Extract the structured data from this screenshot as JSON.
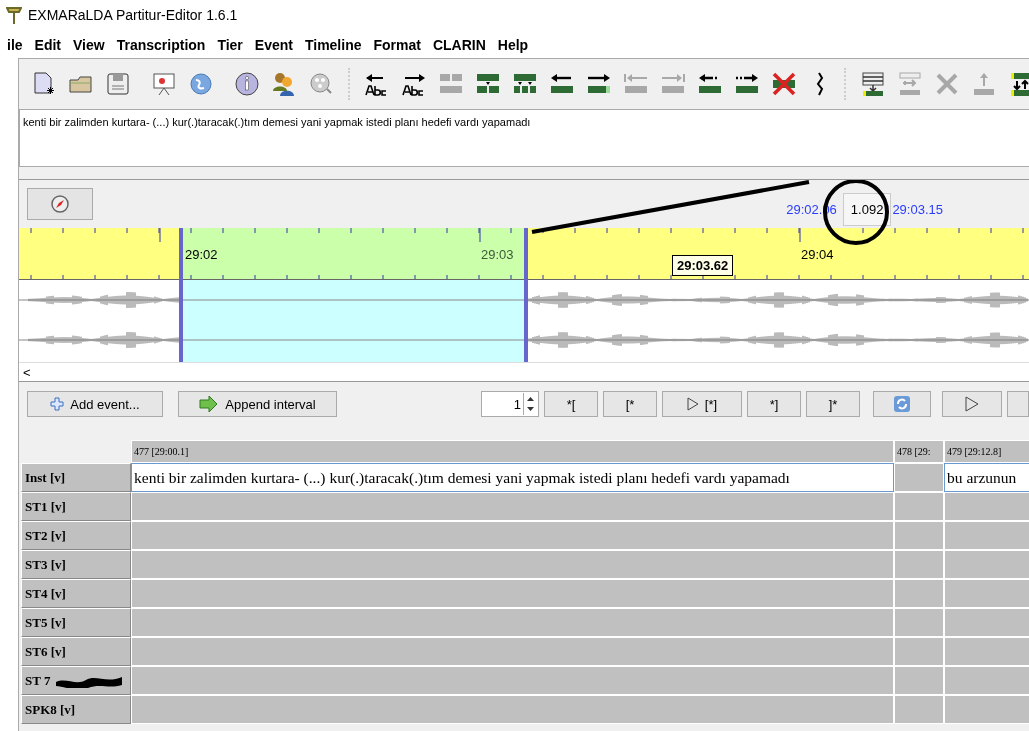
{
  "window": {
    "title": "EXMARaLDA Partitur-Editor 1.6.1"
  },
  "menu": [
    {
      "label": "ile"
    },
    {
      "label": "Edit"
    },
    {
      "label": "View"
    },
    {
      "label": "Transcription"
    },
    {
      "label": "Tier"
    },
    {
      "label": "Event"
    },
    {
      "label": "Timeline"
    },
    {
      "label": "Format"
    },
    {
      "label": "CLARIN"
    },
    {
      "label": "Help"
    }
  ],
  "transcript_text": "kenti bir zalimden kurtara- (...) kur(.)taracak(.)tım demesi yani yapmak istedi planı hedefi vardı yapamadı",
  "timeline": {
    "start_time": "29:02.06",
    "duration": "1.092",
    "end_time": "29:03.15",
    "ruler_labels": [
      "29:02",
      "29:03",
      "29:04"
    ],
    "cursor_time": "29:03.62",
    "scroll_left": "<"
  },
  "controls": {
    "add_event": "Add event...",
    "append_interval": "Append interval",
    "spinner_value": "1",
    "mark_buttons": [
      "*[",
      "[*",
      "[*]",
      "*]",
      "]*"
    ]
  },
  "table": {
    "columns": [
      "477 [29:00.1]",
      "478 [29:",
      "479 [29:12.8]"
    ],
    "rows": [
      {
        "label": "Inst [v]",
        "redacted": false,
        "cells": [
          "kenti bir zalimden kurtara- (...) kur(.)taracak(.)tım demesi yani yapmak istedi planı hedefi vardı yapamadı",
          "",
          "bu arzunun"
        ]
      },
      {
        "label": "ST1 [v]",
        "redacted": false,
        "cells": [
          "",
          "",
          ""
        ]
      },
      {
        "label": "ST2 [v]",
        "redacted": false,
        "cells": [
          "",
          "",
          ""
        ]
      },
      {
        "label": "ST3 [v]",
        "redacted": false,
        "cells": [
          "",
          "",
          ""
        ]
      },
      {
        "label": "ST4 [v]",
        "redacted": false,
        "cells": [
          "",
          "",
          ""
        ]
      },
      {
        "label": "ST5 [v]",
        "redacted": false,
        "cells": [
          "",
          "",
          ""
        ]
      },
      {
        "label": "ST6 [v]",
        "redacted": false,
        "cells": [
          "",
          "",
          ""
        ]
      },
      {
        "label": "ST 7",
        "redacted": true,
        "cells": [
          "",
          "",
          ""
        ]
      },
      {
        "label": "SPK8 [v]",
        "redacted": false,
        "cells": [
          "",
          "",
          ""
        ]
      }
    ]
  }
}
